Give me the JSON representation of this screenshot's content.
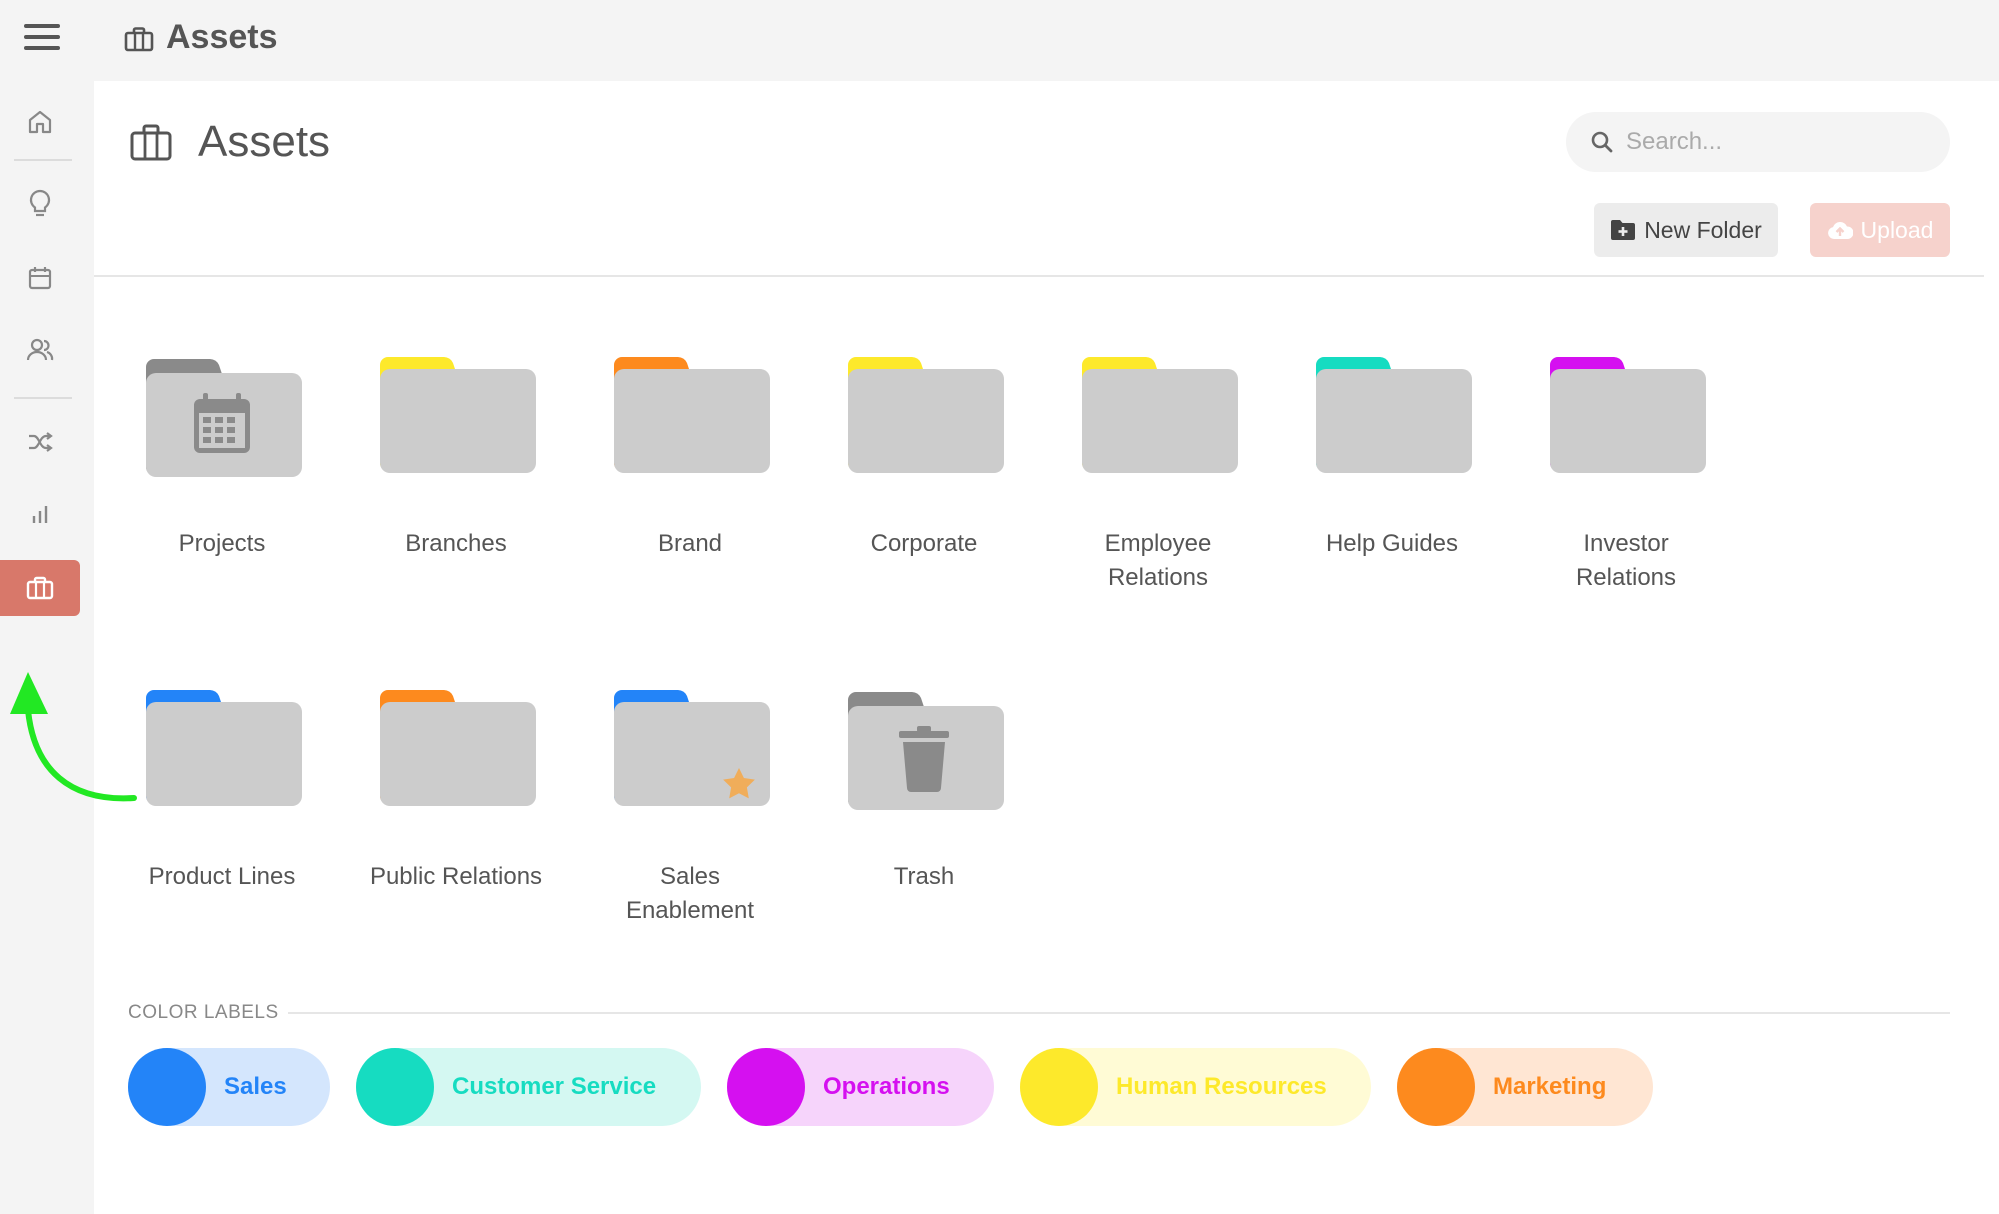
{
  "topbar": {
    "title": "Assets",
    "menu_icon": "hamburger-menu-icon",
    "title_icon": "briefcase-icon"
  },
  "sidebar": {
    "items": [
      {
        "name": "home",
        "icon": "home-icon"
      },
      {
        "name": "ideas",
        "icon": "lightbulb-icon"
      },
      {
        "name": "calendar",
        "icon": "calendar-icon"
      },
      {
        "name": "people",
        "icon": "users-icon"
      },
      {
        "name": "workflows",
        "icon": "shuffle-icon"
      },
      {
        "name": "analytics",
        "icon": "bar-chart-icon"
      },
      {
        "name": "assets",
        "icon": "briefcase-icon",
        "active": true
      }
    ],
    "active_color": "#d8786a"
  },
  "page": {
    "title": "Assets",
    "search": {
      "placeholder": "Search..."
    },
    "new_folder_label": "New Folder",
    "upload_label": "Upload"
  },
  "folders": [
    {
      "label": "Projects",
      "tab_color": "#8a8a8a",
      "emblem": "calendar-icon"
    },
    {
      "label": "Branches",
      "tab_color": "#fde92b"
    },
    {
      "label": "Brand",
      "tab_color": "#fd8a1e"
    },
    {
      "label": "Corporate",
      "tab_color": "#fde92b"
    },
    {
      "label": "Employee Relations",
      "tab_color": "#fde92b"
    },
    {
      "label": "Help Guides",
      "tab_color": "#16dcc1"
    },
    {
      "label": "Investor Relations",
      "tab_color": "#d510f0"
    },
    {
      "label": "Product Lines",
      "tab_color": "#2384f8"
    },
    {
      "label": "Public Relations",
      "tab_color": "#fd8a1e"
    },
    {
      "label": "Sales Enablement",
      "tab_color": "#2384f8",
      "emblem": "star-icon"
    },
    {
      "label": "Trash",
      "tab_color": "#8a8a8a",
      "emblem": "trash-icon"
    }
  ],
  "color_labels": {
    "heading": "COLOR LABELS",
    "items": [
      {
        "label": "Sales",
        "color": "#2384f8",
        "bg": "#d4e6fd"
      },
      {
        "label": "Customer Service",
        "color": "#16dcc1",
        "bg": "#d4f8f2"
      },
      {
        "label": "Operations",
        "color": "#d510f0",
        "bg": "#f6d4fb"
      },
      {
        "label": "Human Resources",
        "color": "#fde92b",
        "bg": "#fffbd5"
      },
      {
        "label": "Marketing",
        "color": "#fd8a1e",
        "bg": "#ffe6d3"
      }
    ]
  },
  "annotation": {
    "arrow_color": "#22e823"
  }
}
